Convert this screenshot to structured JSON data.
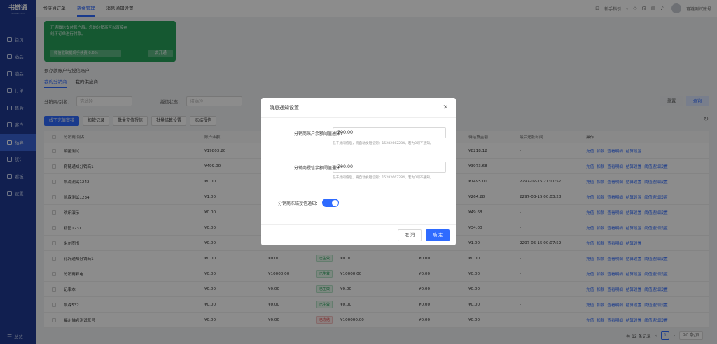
{
  "app": {
    "logo_text": "书链通",
    "logo_sub": "shulian.com"
  },
  "sidebar": {
    "items": [
      {
        "label": "首页",
        "icon": "home-icon"
      },
      {
        "label": "选品",
        "icon": "select-icon"
      },
      {
        "label": "商品",
        "icon": "product-icon"
      },
      {
        "label": "订单",
        "icon": "order-icon"
      },
      {
        "label": "售后",
        "icon": "aftersale-icon"
      },
      {
        "label": "客户",
        "icon": "customer-icon"
      },
      {
        "label": "结算",
        "icon": "settlement-icon",
        "active": true
      },
      {
        "label": "统计",
        "icon": "stats-icon"
      },
      {
        "label": "看板",
        "icon": "dashboard-icon"
      },
      {
        "label": "设置",
        "icon": "settings-icon"
      }
    ],
    "footer_label": "总览"
  },
  "topbar": {
    "tabs": [
      "书链通订单",
      "资金管理",
      "消息通知设置"
    ],
    "active_tab": 1,
    "guide": "新手指引",
    "user": "育链测试账号"
  },
  "promo": {
    "line1": "开通微信支付账户后，您的分销商可以直接在",
    "line2": "线下订单进行付款。",
    "fee": "微信收取提现手续费 0.6%",
    "button": "去开通"
  },
  "section_title": "预存款账户与授信账户",
  "subtabs": [
    "我的分销商",
    "我的供应商"
  ],
  "filters": {
    "label1": "分销商/别名：",
    "placeholder1": "请选择",
    "label2": "授信状态：",
    "placeholder2": "请选择",
    "reset": "重置",
    "query": "查询"
  },
  "actions": [
    "线下充值审核",
    "扣款记录",
    "批量充值授信",
    "批量结算设置",
    "冻结授信"
  ],
  "table": {
    "headers": [
      "分销商/别名",
      "账户余额",
      "",
      "",
      "",
      "",
      "待结算金额",
      "最后还款时间",
      "操作"
    ],
    "rows": [
      {
        "name": "明星测试",
        "balance": "¥19803.20",
        "credit": "",
        "status": "",
        "c5": "",
        "c6": "",
        "pending": "¥8218.12",
        "last": "-",
        "ops": [
          "充值",
          "扣款",
          "查看明细",
          "结算设置"
        ]
      },
      {
        "name": "育链通知分销商1",
        "balance": "¥499.00",
        "credit": "",
        "status": "",
        "c5": "",
        "c6": "",
        "pending": "¥3973.68",
        "last": "-",
        "ops": [
          "充值",
          "扣款",
          "查看明细",
          "结算设置",
          "阈值通知设置"
        ]
      },
      {
        "name": "凯森测试1242",
        "balance": "¥0.00",
        "credit": "",
        "status": "",
        "c5": "",
        "c6": "",
        "pending": "¥1495.00",
        "last": "2297-07-15 21:11:57",
        "ops": [
          "充值",
          "扣款",
          "查看明细",
          "结算设置",
          "阈值通知设置"
        ]
      },
      {
        "name": "凯森测试1234",
        "balance": "¥1.00",
        "credit": "",
        "status": "",
        "c5": "",
        "c6": "",
        "pending": "¥264.28",
        "last": "2297-03-15 00:03:28",
        "ops": [
          "充值",
          "扣款",
          "查看明细",
          "结算设置",
          "阈值通知设置"
        ]
      },
      {
        "name": "欢乐演示",
        "balance": "¥0.00",
        "credit": "",
        "status": "",
        "c5": "",
        "c6": "",
        "pending": "¥49.68",
        "last": "-",
        "ops": [
          "充值",
          "扣款",
          "查看明细",
          "结算设置",
          "阈值通知设置"
        ]
      },
      {
        "name": "初园1231",
        "balance": "¥0.00",
        "credit": "",
        "status": "",
        "c5": "",
        "c6": "",
        "pending": "¥34.00",
        "last": "-",
        "ops": [
          "充值",
          "扣款",
          "查看明细",
          "结算设置",
          "阈值通知设置"
        ]
      },
      {
        "name": "米尔图书",
        "balance": "¥0.00",
        "credit": "¥0.00",
        "status": "",
        "c5": "",
        "c6": "",
        "pending": "¥1.00",
        "last": "2297-05-15 00:07:52",
        "ops": [
          "充值",
          "扣款",
          "查看明细",
          "结算设置"
        ]
      },
      {
        "name": "花辞通知分销商1",
        "balance": "¥0.00",
        "credit": "¥0.00",
        "status": "已生效",
        "c5": "¥0.00",
        "c6": "¥0.00",
        "pending": "¥0.00",
        "last": "-",
        "ops": [
          "充值",
          "扣款",
          "查看明细",
          "结算设置",
          "阈值通知设置"
        ]
      },
      {
        "name": "分销商彩电",
        "balance": "¥0.00",
        "credit": "¥10000.00",
        "status": "已生效",
        "c5": "¥10000.00",
        "c6": "¥0.00",
        "pending": "¥0.00",
        "last": "-",
        "ops": [
          "充值",
          "扣款",
          "查看明细",
          "结算设置",
          "阈值通知设置"
        ]
      },
      {
        "name": "记事本",
        "balance": "¥0.00",
        "credit": "¥0.00",
        "status": "已生效",
        "c5": "¥0.00",
        "c6": "¥0.00",
        "pending": "¥0.00",
        "last": "-",
        "ops": [
          "充值",
          "扣款",
          "查看明细",
          "结算设置",
          "阈值通知设置"
        ]
      },
      {
        "name": "凯森532",
        "balance": "¥0.00",
        "credit": "¥0.00",
        "status": "已生效",
        "c5": "¥0.00",
        "c6": "¥0.00",
        "pending": "¥0.00",
        "last": "-",
        "ops": [
          "充值",
          "扣款",
          "查看明细",
          "结算设置",
          "阈值通知设置"
        ]
      },
      {
        "name": "福州佛岩测试账号",
        "balance": "¥0.00",
        "credit": "¥0.00",
        "status": "已冻结",
        "c5": "¥100000.00",
        "c6": "¥0.00",
        "pending": "¥0.00",
        "last": "-",
        "ops": [
          "充值",
          "扣款",
          "查看明细",
          "结算设置",
          "阈值通知设置"
        ]
      }
    ]
  },
  "pager": {
    "total": "共 12 条记录",
    "current": "1",
    "page_size": "20 条/页"
  },
  "modal": {
    "title": "消息通知设置",
    "field1_label": "分销商账户余额阈值通知：",
    "field1_value": "200.00",
    "field1_hint": "低于此阈值后，将自动发短信到：15282662284。若为0则不通知。",
    "field2_label": "分销商授信余额阈值通知：",
    "field2_value": "200.00",
    "field2_hint": "低于此阈值后，将自动发短信到：15282662284。若为0则不通知。",
    "toggle_label": "分销商冻结授信通知：",
    "toggle_on": true,
    "cancel": "取 消",
    "ok": "确 定"
  }
}
